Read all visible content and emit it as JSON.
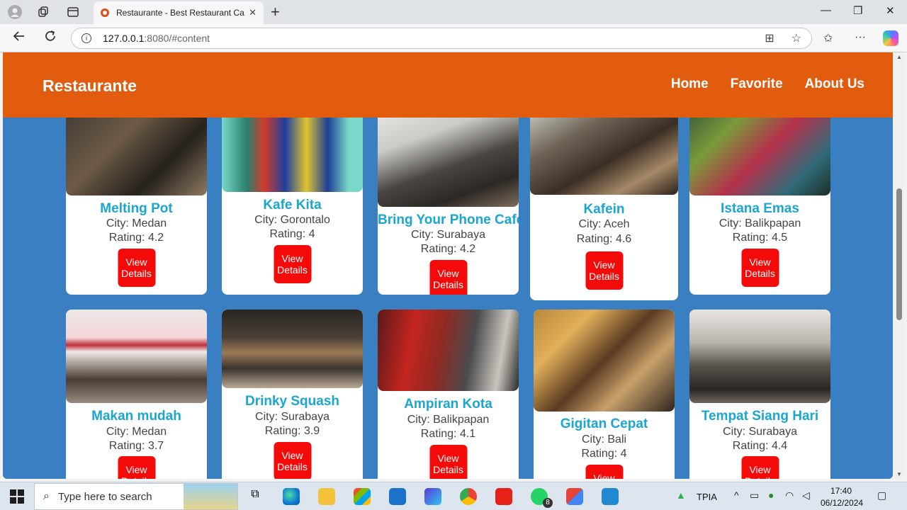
{
  "browser": {
    "tab_title": "Restaurante - Best Restaurant Cat",
    "tab_close": "✕",
    "new_tab": "+",
    "url_host": "127.0.0.1",
    "url_rest": ":8080/#content",
    "window_controls": [
      "—",
      "❐",
      "✕"
    ]
  },
  "app": {
    "brand": "Restaurante",
    "nav": [
      "Home",
      "Favorite",
      "About Us"
    ]
  },
  "cards_row1": [
    {
      "name": "Melting Pot",
      "city": "City: Medan",
      "rating": "Rating: 4.2",
      "button": "View Details"
    },
    {
      "name": "Kafe Kita",
      "city": "City: Gorontalo",
      "rating": "Rating: 4",
      "button": "View Details"
    },
    {
      "name": "Bring Your Phone Cafe",
      "city": "City: Surabaya",
      "rating": "Rating: 4.2",
      "button": "View Details"
    },
    {
      "name": "Kafein",
      "city": "City: Aceh",
      "rating": "Rating: 4.6",
      "button": "View Details"
    },
    {
      "name": "Istana Emas",
      "city": "City: Balikpapan",
      "rating": "Rating: 4.5",
      "button": "View Details"
    }
  ],
  "cards_row2": [
    {
      "name": "Makan mudah",
      "city": "City: Medan",
      "rating": "Rating: 3.7",
      "button": "View Details"
    },
    {
      "name": "Drinky Squash",
      "city": "City: Surabaya",
      "rating": "Rating: 3.9",
      "button": "View Details"
    },
    {
      "name": "Ampiran Kota",
      "city": "City: Balikpapan",
      "rating": "Rating: 4.1",
      "button": "View Details"
    },
    {
      "name": "Gigitan Cepat",
      "city": "City: Bali",
      "rating": "Rating: 4",
      "button": "View Details"
    },
    {
      "name": "Tempat Siang Hari",
      "city": "City: Surabaya",
      "rating": "Rating: 4.4",
      "button": "View Details"
    }
  ],
  "taskbar": {
    "search_placeholder": "Type here to search",
    "weather_label": "TPIA",
    "whatsapp_badge": "8",
    "time": "17:40",
    "date": "06/12/2024"
  },
  "colors": {
    "appbar": "#e25c10",
    "page_bg": "#3a7fc1",
    "card_title": "#1aa6d1",
    "button": "#f50a0a"
  }
}
